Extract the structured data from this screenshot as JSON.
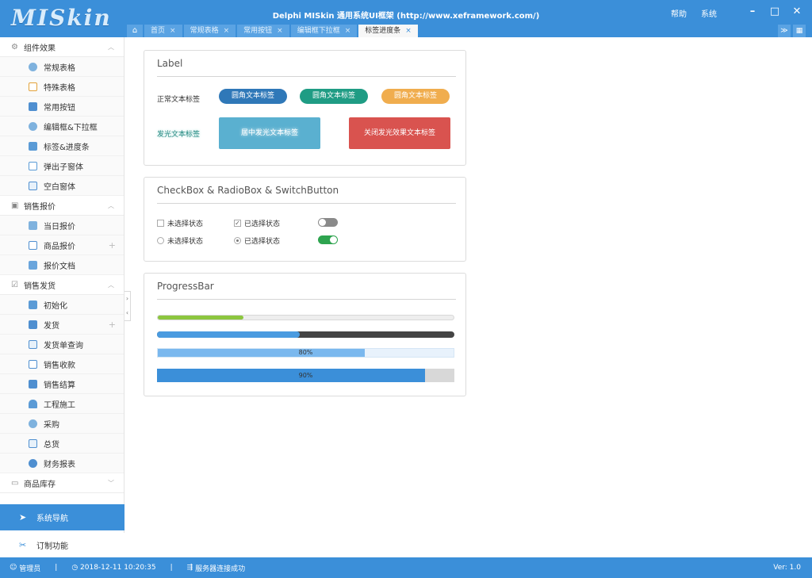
{
  "app": {
    "logo": "MISkin",
    "title": "Delphi MISkin 通用系统UI框架 (http://www.xeframework.com/)",
    "help": "帮助",
    "system": "系统",
    "accent": "#3b8fd9"
  },
  "tabs": [
    {
      "label": "首页"
    },
    {
      "label": "常规表格"
    },
    {
      "label": "常用按钮"
    },
    {
      "label": "编辑框下拉框"
    },
    {
      "label": "标签进度条"
    }
  ],
  "sidebar": {
    "groups": [
      {
        "label": "组件效果",
        "items": [
          {
            "label": "常规表格"
          },
          {
            "label": "特殊表格"
          },
          {
            "label": "常用按钮"
          },
          {
            "label": "编辑框&下拉框"
          },
          {
            "label": "标签&进度条"
          },
          {
            "label": "弹出子窗体"
          },
          {
            "label": "空白窗体"
          }
        ]
      },
      {
        "label": "销售报价",
        "items": [
          {
            "label": "当日报价"
          },
          {
            "label": "商品报价"
          },
          {
            "label": "报价文档"
          }
        ]
      },
      {
        "label": "销售发货",
        "items": [
          {
            "label": "初始化"
          },
          {
            "label": "发货"
          },
          {
            "label": "发货单查询"
          },
          {
            "label": "销售收款"
          },
          {
            "label": "销售结算"
          },
          {
            "label": "工程施工"
          },
          {
            "label": "采购"
          },
          {
            "label": "总货"
          },
          {
            "label": "财务报表"
          }
        ]
      },
      {
        "label": "商品库存",
        "items": []
      }
    ],
    "nav_button": "系统导航",
    "custom_button": "订制功能"
  },
  "label_panel": {
    "title": "Label",
    "normal_label": "正常文本标签",
    "rounded_1": "圆角文本标签",
    "rounded_2": "圆角文本标签",
    "rounded_3": "圆角文本标签",
    "glow_label": "发光文本标签",
    "glow_center": "居中发光文本标签",
    "glow_off": "关闭发光效果文本标签"
  },
  "check_panel": {
    "title": "CheckBox & RadioBox & SwitchButton",
    "cb_unchecked": "未选择状态",
    "cb_checked": "已选择状态",
    "rb_unchecked": "未选择状态",
    "rb_checked": "已选择状态",
    "switch_1_on": false,
    "switch_2_on": true
  },
  "progress_panel": {
    "title": "ProgressBar",
    "bar1": 0.29,
    "bar2": 0.48,
    "bar3_label": "80%",
    "bar3": 0.7,
    "bar4_label": "90%",
    "bar4": 0.9
  },
  "status": {
    "user": "管理员",
    "datetime": "2018-12-11 10:20:35",
    "server": "服务器连接成功",
    "version": "Ver: 1.0"
  }
}
